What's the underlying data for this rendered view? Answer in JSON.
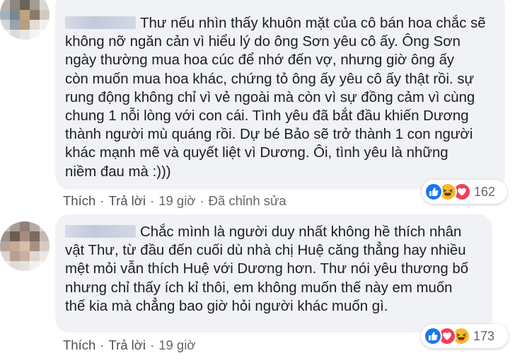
{
  "comments": [
    {
      "body_lines": [
        "Thư nếu nhìn thấy khuôn mặt của cô bán hoa chắc sẽ",
        "không nỡ ngăn cản vì hiểu lý do ông Sơn yêu cô ấy. Ông Sơn",
        "ngày thường mua hoa cúc để nhớ đến vợ, nhưng giờ ông ấy",
        "còn muốn mua hoa khác, chứng tỏ ông ấy yêu cô ấy thật rồi. sự",
        "rung động không chỉ vì vẻ ngoài mà còn vì sự đồng cảm vì cùng",
        "chung 1 nỗi lòng với con cái. Tình yêu đã bắt đầu khiến Dương",
        "thành người mù quáng rồi. Dự bé Bảo sẽ trở thành 1 con người",
        "khác mạnh mẽ và quyết liệt vì Dương. Ôi, tình yêu là những",
        "niềm đau mà :)))"
      ],
      "actions": {
        "like": "Thích",
        "reply": "Trả lời",
        "time": "19 giờ",
        "edited": "Đã chỉnh sửa"
      },
      "reactions": {
        "icons": [
          "like-icon",
          "haha-icon",
          "love-icon"
        ],
        "count": "162"
      }
    },
    {
      "body_lines": [
        "Chắc mình là người duy nhất không hề thích nhân",
        "vật Thư, từ đầu đến cuối dù nhà chị Huệ căng thẳng hay nhiều",
        "mệt mỏi vẫn thích Huệ với Dương hơn. Thư nói yêu thương bố",
        "nhưng chỉ thấy ích kỉ thôi, em không muốn thế này em muốn",
        "thế kia mà chẳng bao giờ hỏi người khác muốn gì."
      ],
      "actions": {
        "like": "Thích",
        "reply": "Trả lời",
        "time": "19 giờ"
      },
      "reactions": {
        "icons": [
          "like-icon",
          "love-icon",
          "haha-icon"
        ],
        "count": "173"
      }
    }
  ],
  "colors": {
    "like": "#1877f2",
    "haha": "#f7b928",
    "love": "#f33e58",
    "bubble": "#f0f2f5",
    "meta_text": "#65676b"
  }
}
